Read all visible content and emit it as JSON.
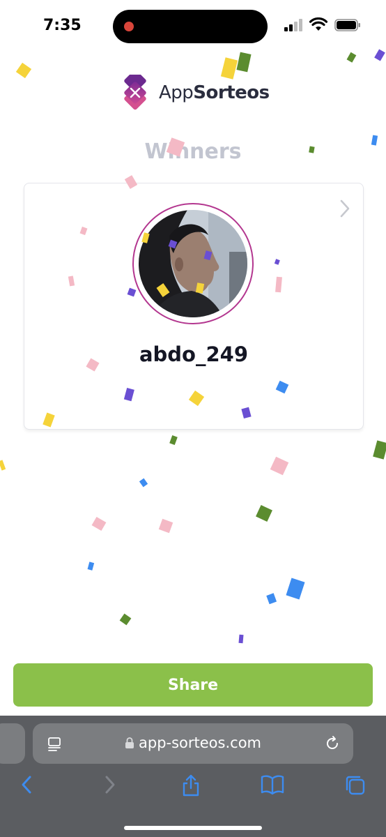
{
  "status_bar": {
    "time": "7:35"
  },
  "logo": {
    "text_regular": "App",
    "text_bold": "Sorteos"
  },
  "section_title": "Winners",
  "winner": {
    "username": "abdo_249"
  },
  "share_label": "Share",
  "browser": {
    "url": "app-sorteos.com"
  },
  "colors": {
    "accent_green": "#8bc04a",
    "brand_magenta": "#b3368f",
    "title_gray": "#c2c5d0",
    "toolbar_blue": "#3d8cf0"
  }
}
